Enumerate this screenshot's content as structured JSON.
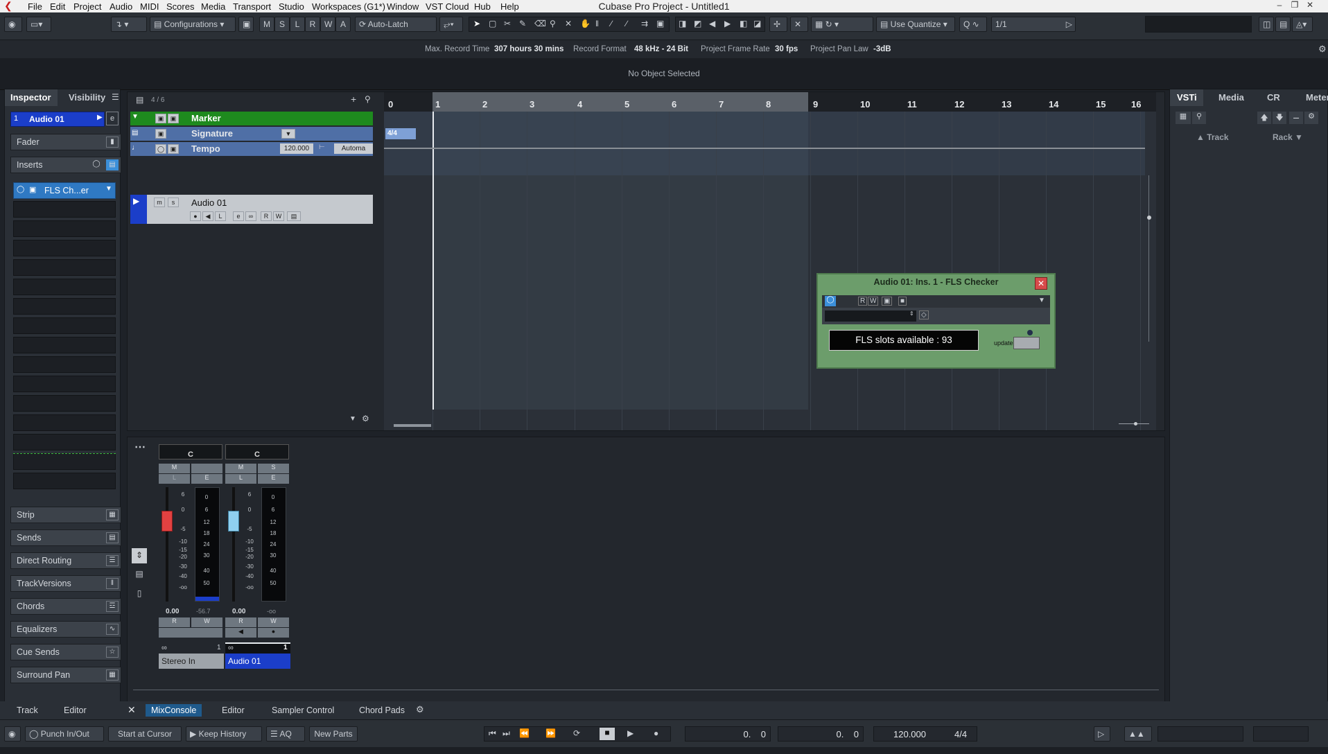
{
  "app": {
    "title": "Cubase Pro Project - Untitled1"
  },
  "menu": [
    "File",
    "Edit",
    "Project",
    "Audio",
    "MIDI",
    "Scores",
    "Media",
    "Transport",
    "Studio",
    "Workspaces (G1*)",
    "Window",
    "VST Cloud",
    "Hub",
    "Help"
  ],
  "toolbar": {
    "configurations": "Configurations",
    "msl": [
      "M",
      "S",
      "L",
      "R",
      "W",
      "A"
    ],
    "autolatch": "Auto-Latch",
    "use_quantize": "Use Quantize",
    "quantize_value": "1/1"
  },
  "infoline": {
    "max_record_label": "Max. Record Time",
    "max_record_value": "307 hours 30 mins",
    "record_format_label": "Record Format",
    "record_format_value": "48 kHz - 24 Bit",
    "frame_rate_label": "Project Frame Rate",
    "frame_rate_value": "30 fps",
    "pan_law_label": "Project Pan Law",
    "pan_law_value": "-3dB",
    "no_object": "No Object Selected"
  },
  "inspector": {
    "tabs": [
      "Inspector",
      "Visibility"
    ],
    "track_name": "Audio 01",
    "track_number": "1",
    "fader": "Fader",
    "inserts": "Inserts",
    "insert_slot": "FLS Ch...er",
    "sections": [
      "Strip",
      "Sends",
      "Direct Routing",
      "TrackVersions",
      "Chords",
      "Equalizers",
      "Cue Sends",
      "Surround Pan"
    ]
  },
  "tracklist": {
    "count": "4 / 6",
    "marker": "Marker",
    "signature": "Signature",
    "tempo": "Tempo",
    "tempo_value": "120.000",
    "automation": "Automa",
    "audio_track": "Audio 01",
    "signature_event": "4/4"
  },
  "ruler": [
    "0",
    "1",
    "2",
    "3",
    "4",
    "5",
    "6",
    "7",
    "8",
    "9",
    "10",
    "11",
    "12",
    "13",
    "14",
    "15",
    "16"
  ],
  "rightzone": {
    "tabs": [
      "VSTi",
      "Media",
      "CR",
      "Meter"
    ],
    "track_col": "Track",
    "rack_col": "Rack"
  },
  "plugin": {
    "title": "Audio 01: Ins. 1 - FLS Checker",
    "slots_text": "FLS slots available : 93",
    "update_label": "update"
  },
  "mixer": {
    "channels": [
      {
        "pan": "C",
        "fader_value": "0.00",
        "peak": "-56.7",
        "name": "Stereo In",
        "input": "1",
        "color": "#e24141"
      },
      {
        "pan": "C",
        "fader_value": "0.00",
        "peak": "-oo",
        "name": "Audio 01",
        "input": "1",
        "color": "#8fd0f0"
      }
    ],
    "scale_left": [
      "6",
      "0",
      "-5",
      "-10",
      "-15",
      "-20",
      "-30",
      "-40",
      "-oo"
    ],
    "scale_meter": [
      "0",
      "6",
      "12",
      "18",
      "24",
      "30",
      "40",
      "50"
    ]
  },
  "bottomtabs": {
    "left": [
      "Track",
      "Editor"
    ],
    "lower": [
      "MixConsole",
      "Editor",
      "Sampler Control",
      "Chord Pads"
    ]
  },
  "transport": {
    "punch": "Punch In/Out",
    "start_at_cursor": "Start at Cursor",
    "keep_history": "Keep History",
    "aq": "AQ",
    "new_parts": "New Parts",
    "pos1": "0.    0",
    "pos2": "0.    0",
    "tempo": "120.000",
    "signature": "4/4"
  }
}
